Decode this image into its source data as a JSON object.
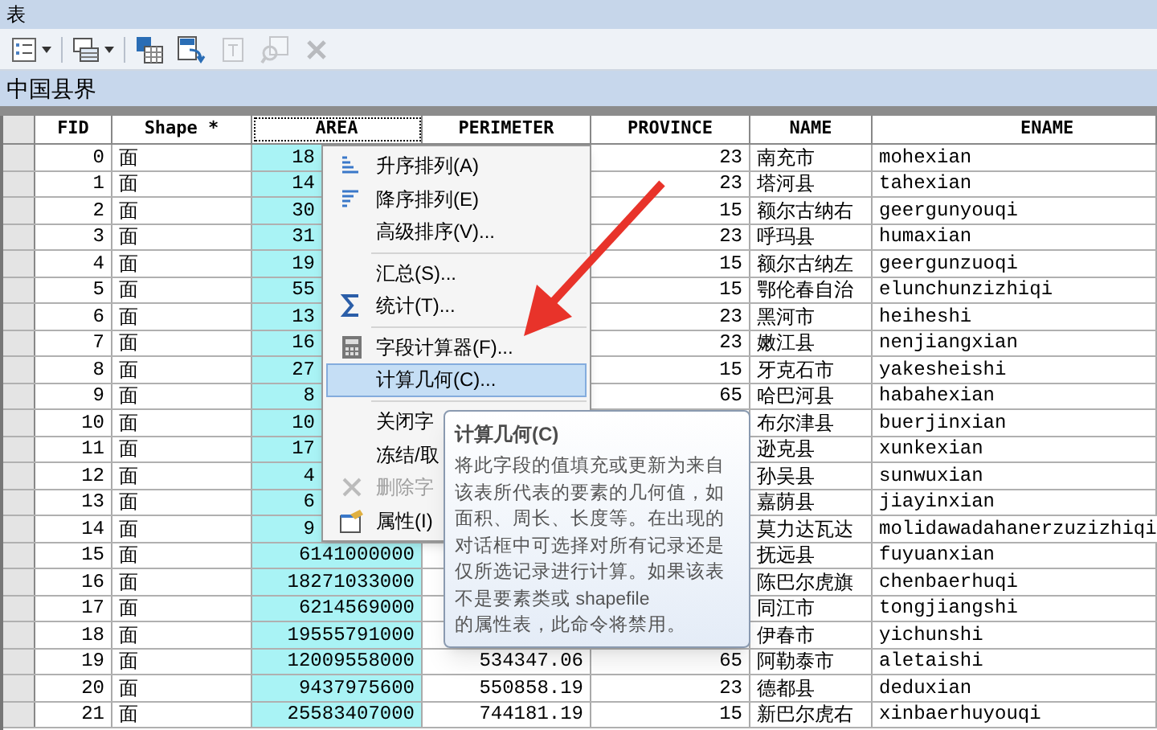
{
  "window": {
    "title": "表"
  },
  "toolbar": {
    "buttons": [
      {
        "kind": "table-options",
        "disabled": false
      },
      {
        "kind": "related",
        "disabled": false
      },
      {
        "kind": "select-by-attributes",
        "disabled": false
      },
      {
        "kind": "switch-selection",
        "disabled": false
      },
      {
        "kind": "clear-selection",
        "disabled": true
      },
      {
        "kind": "zoom-selected",
        "disabled": true
      },
      {
        "kind": "delete",
        "disabled": true
      }
    ]
  },
  "layer_title": "中国县界",
  "table": {
    "columns": [
      {
        "label": "FID",
        "selected": false
      },
      {
        "label": "Shape *",
        "selected": false
      },
      {
        "label": "AREA",
        "selected": true
      },
      {
        "label": "PERIMETER",
        "selected": false
      },
      {
        "label": "PROVINCE",
        "selected": false
      },
      {
        "label": "NAME",
        "selected": false
      },
      {
        "label": "ENAME",
        "selected": false
      }
    ],
    "rows": [
      [
        "0",
        "面",
        "18",
        null,
        "23",
        "南充市",
        "mohexian"
      ],
      [
        "1",
        "面",
        "14",
        null,
        "23",
        "塔河县",
        "tahexian"
      ],
      [
        "2",
        "面",
        "30",
        null,
        "15",
        "额尔古纳右",
        "geergunyouqi"
      ],
      [
        "3",
        "面",
        "31",
        null,
        "23",
        "呼玛县",
        "humaxian"
      ],
      [
        "4",
        "面",
        "19",
        null,
        "15",
        "额尔古纳左",
        "geergunzuoqi"
      ],
      [
        "5",
        "面",
        "55",
        null,
        "15",
        "鄂伦春自治",
        "elunchunzizhiqi"
      ],
      [
        "6",
        "面",
        "13",
        null,
        "23",
        "黑河市",
        "heiheshi"
      ],
      [
        "7",
        "面",
        "16",
        null,
        "23",
        "嫩江县",
        "nenjiangxian"
      ],
      [
        "8",
        "面",
        "27",
        null,
        "15",
        "牙克石市",
        "yakesheishi"
      ],
      [
        "9",
        "面",
        "8",
        null,
        "65",
        "哈巴河县",
        "habahexian"
      ],
      [
        "10",
        "面",
        "10",
        null,
        null,
        "布尔津县",
        "buerjinxian"
      ],
      [
        "11",
        "面",
        "17",
        null,
        null,
        "逊克县",
        "xunkexian"
      ],
      [
        "12",
        "面",
        "4",
        null,
        null,
        "孙吴县",
        "sunwuxian"
      ],
      [
        "13",
        "面",
        "6",
        null,
        null,
        "嘉荫县",
        "jiayinxian"
      ],
      [
        "14",
        "面",
        "9",
        null,
        null,
        "莫力达瓦达",
        "molidawadahanerzuzizhiqi"
      ],
      [
        "15",
        "面",
        "6141000000",
        null,
        null,
        "抚远县",
        "fuyuanxian"
      ],
      [
        "16",
        "面",
        "18271033000",
        null,
        null,
        "陈巴尔虎旗",
        "chenbaerhuqi"
      ],
      [
        "17",
        "面",
        "6214569000",
        null,
        null,
        "同江市",
        "tongjiangshi"
      ],
      [
        "18",
        "面",
        "19555791000",
        null,
        null,
        "伊春市",
        "yichunshi"
      ],
      [
        "19",
        "面",
        "12009558000",
        "534347.06",
        "65",
        "阿勒泰市",
        "aletaishi"
      ],
      [
        "20",
        "面",
        "9437975600",
        "550858.19",
        "23",
        "德都县",
        "deduxian"
      ],
      [
        "21",
        "面",
        "25583407000",
        "744181.19",
        "15",
        "新巴尔虎右",
        "xinbaerhuyouqi"
      ]
    ]
  },
  "context_menu": {
    "items": [
      {
        "kind": "item",
        "label": "升序排列(A)",
        "selected": false,
        "disabled": false
      },
      {
        "kind": "item",
        "label": "降序排列(E)",
        "selected": false,
        "disabled": false
      },
      {
        "kind": "item",
        "label": "高级排序(V)...",
        "selected": false,
        "disabled": false
      },
      {
        "kind": "separator"
      },
      {
        "kind": "item",
        "label": "汇总(S)...",
        "selected": false,
        "disabled": false
      },
      {
        "kind": "item",
        "label": "统计(T)...",
        "selected": false,
        "disabled": false
      },
      {
        "kind": "separator"
      },
      {
        "kind": "item",
        "label": "字段计算器(F)...",
        "selected": false,
        "disabled": false
      },
      {
        "kind": "item",
        "label": "计算几何(C)...",
        "selected": true,
        "disabled": false
      },
      {
        "kind": "separator"
      },
      {
        "kind": "item",
        "label": "关闭字",
        "selected": false,
        "disabled": false
      },
      {
        "kind": "item",
        "label": "冻结/取",
        "selected": false,
        "disabled": false
      },
      {
        "kind": "item",
        "label": "删除字",
        "selected": false,
        "disabled": true
      },
      {
        "kind": "item",
        "label": "属性(I)",
        "selected": false,
        "disabled": false
      }
    ]
  },
  "tooltip": {
    "title": "计算几何(C)",
    "text": "将此字段的值填充或更新为来自该表所代表的要素的几何值，如面积、周长、长度等。在出现的对话框中可选择对所有记录还是仅所选记录进行计算。如果该表不是要素类或 shapefile\n的属性表，此命令将禁用。"
  }
}
